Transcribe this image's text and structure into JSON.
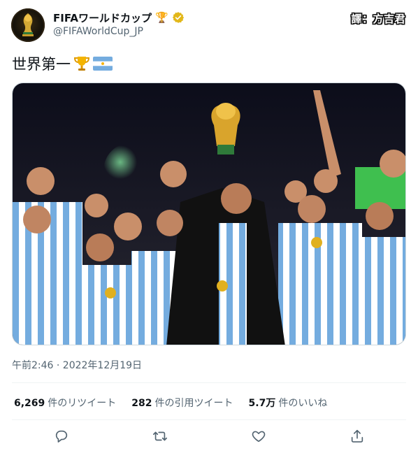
{
  "account": {
    "display_name": "FIFAワールドカップ",
    "trophy_emoji": "🏆",
    "handle": "@FIFAWorldCup_JP",
    "verified_color": "#e2b719"
  },
  "translator_credit": "譯：方吉君",
  "tweet": {
    "text": "世界第一",
    "emojis": [
      "trophy-icon",
      "argentina-flag-icon"
    ]
  },
  "photo": {
    "subject": "Argentina team celebrating with the World Cup trophy"
  },
  "timestamp": "午前2:46 · 2022年12月19日",
  "stats": {
    "retweets_count": "6,269",
    "retweets_label": "件のリツイート",
    "quotes_count": "282",
    "quotes_label": "件の引用ツイート",
    "likes_count": "5.7万",
    "likes_label": "件のいいね"
  },
  "actions": [
    "reply-icon",
    "retweet-icon",
    "like-icon",
    "share-icon"
  ],
  "colors": {
    "text_primary": "#0f1419",
    "text_secondary": "#536471",
    "divider": "#eff3f4",
    "argentina_blue": "#74acdf"
  }
}
